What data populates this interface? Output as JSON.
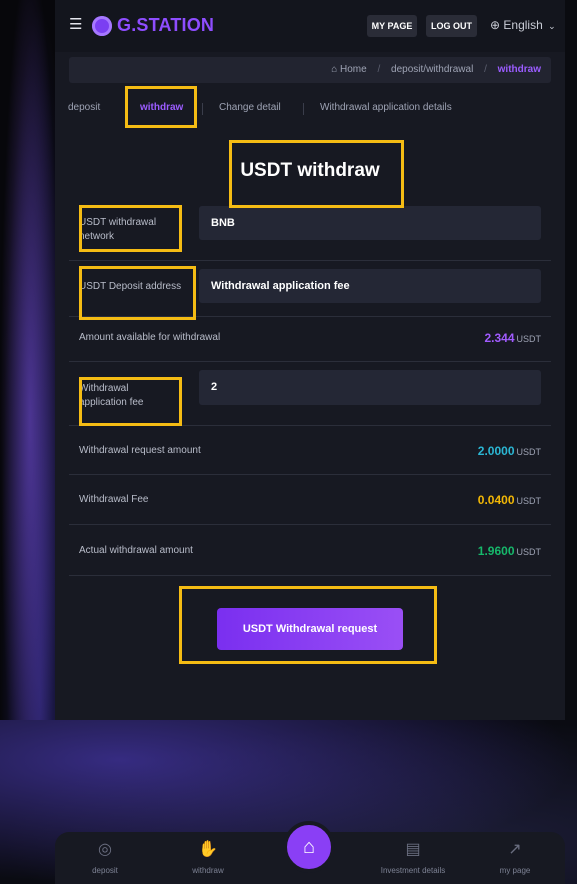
{
  "header": {
    "logo": "G.STATION",
    "my_page_label": "MY PAGE",
    "logout_label": "LOG OUT",
    "language": "English"
  },
  "breadcrumb": {
    "home": "Home",
    "section": "deposit/withdrawal",
    "current": "withdraw"
  },
  "tabs": [
    "deposit",
    "withdraw",
    "Change detail",
    "Withdrawal application details"
  ],
  "page_title": "USDT withdraw",
  "form": {
    "network_label": "USDT withdrawal network",
    "network_value": "BNB",
    "address_label": "USDT Deposit address",
    "address_value": "Withdrawal application fee",
    "available_label": "Amount available for withdrawal",
    "available_value": "2.344",
    "fee_input_label": "Withdrawal application fee",
    "fee_input_value": "2",
    "request_amount_label": "Withdrawal request amount",
    "request_amount_value": "2.0000",
    "fee_label": "Withdrawal Fee",
    "fee_value": "0.0400",
    "actual_label": "Actual withdrawal amount",
    "actual_value": "1.9600",
    "unit": "USDT"
  },
  "submit_label": "USDT Withdrawal request",
  "bottom_nav": [
    "deposit",
    "withdraw",
    "Investment details",
    "my page"
  ],
  "colors": {
    "accent": "#8e4dff",
    "highlight": "#f5bc14",
    "available": "#a15bff",
    "request": "#2bb7d4",
    "fee": "#f2b705",
    "actual": "#16b86b"
  },
  "icons": [
    "menu-icon",
    "logo-icon",
    "globe-icon",
    "chevron-down-icon",
    "home-icon",
    "coin-icon",
    "hand-coin-icon",
    "receipt-icon",
    "chart-line-icon"
  ]
}
